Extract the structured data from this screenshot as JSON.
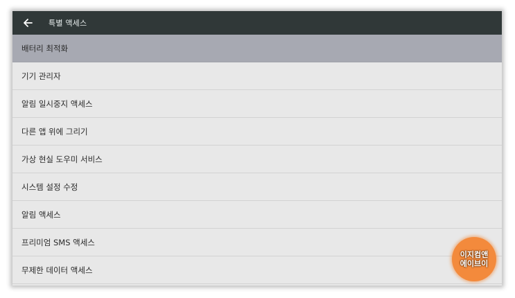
{
  "header": {
    "title": "특별 액세스"
  },
  "items": [
    {
      "label": "배터리 최적화",
      "selected": true
    },
    {
      "label": "기기 관리자"
    },
    {
      "label": "알림 일시중지 액세스"
    },
    {
      "label": "다른 앱 위에 그리기"
    },
    {
      "label": "가상 현실 도우미 서비스"
    },
    {
      "label": "시스템 설정 수정"
    },
    {
      "label": "알림 액세스"
    },
    {
      "label": "프리미엄 SMS 액세스"
    },
    {
      "label": "무제한 데이터 액세스"
    }
  ],
  "watermark": {
    "line1": "이지컴앤",
    "line2": "에이브이"
  },
  "colors": {
    "appbar": "#303838",
    "selected_row": "#a7a9b2",
    "list_bg": "#e8e8e8",
    "watermark": "#f38a3c"
  },
  "icons": {
    "back": "arrow-left-icon"
  }
}
